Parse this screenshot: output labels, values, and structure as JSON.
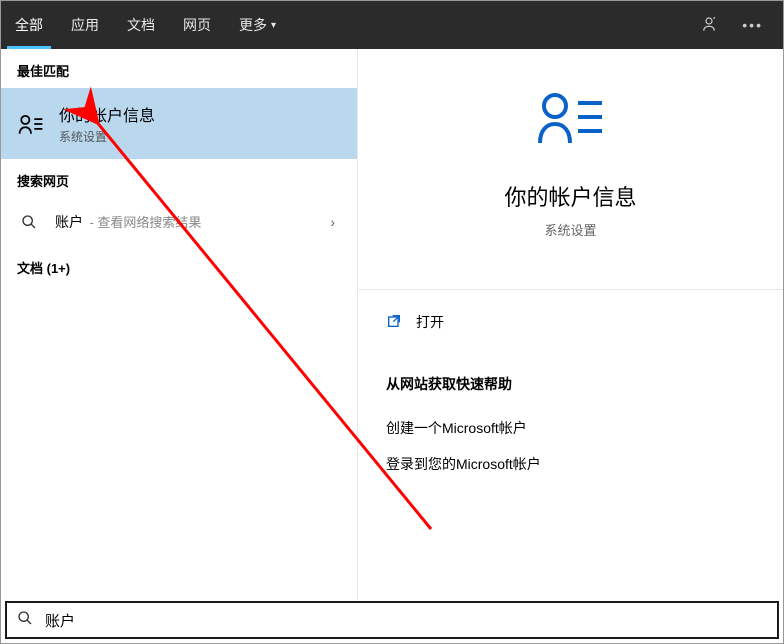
{
  "topbar": {
    "tabs": [
      {
        "label": "全部",
        "active": true
      },
      {
        "label": "应用"
      },
      {
        "label": "文档"
      },
      {
        "label": "网页"
      },
      {
        "label": "更多",
        "chevron": true
      }
    ]
  },
  "left": {
    "best_match_header": "最佳匹配",
    "best_match": {
      "title": "你的帐户信息",
      "subtitle": "系统设置"
    },
    "search_web_header": "搜索网页",
    "web_item": {
      "label": "账户",
      "hint": "- 查看网络搜索结果"
    },
    "docs_header": "文档 (1+)"
  },
  "preview": {
    "title": "你的帐户信息",
    "subtitle": "系统设置",
    "open_label": "打开",
    "help_header": "从网站获取快速帮助",
    "help_links": [
      "创建一个Microsoft帐户",
      "登录到您的Microsoft帐户"
    ]
  },
  "search": {
    "value": "账户"
  }
}
